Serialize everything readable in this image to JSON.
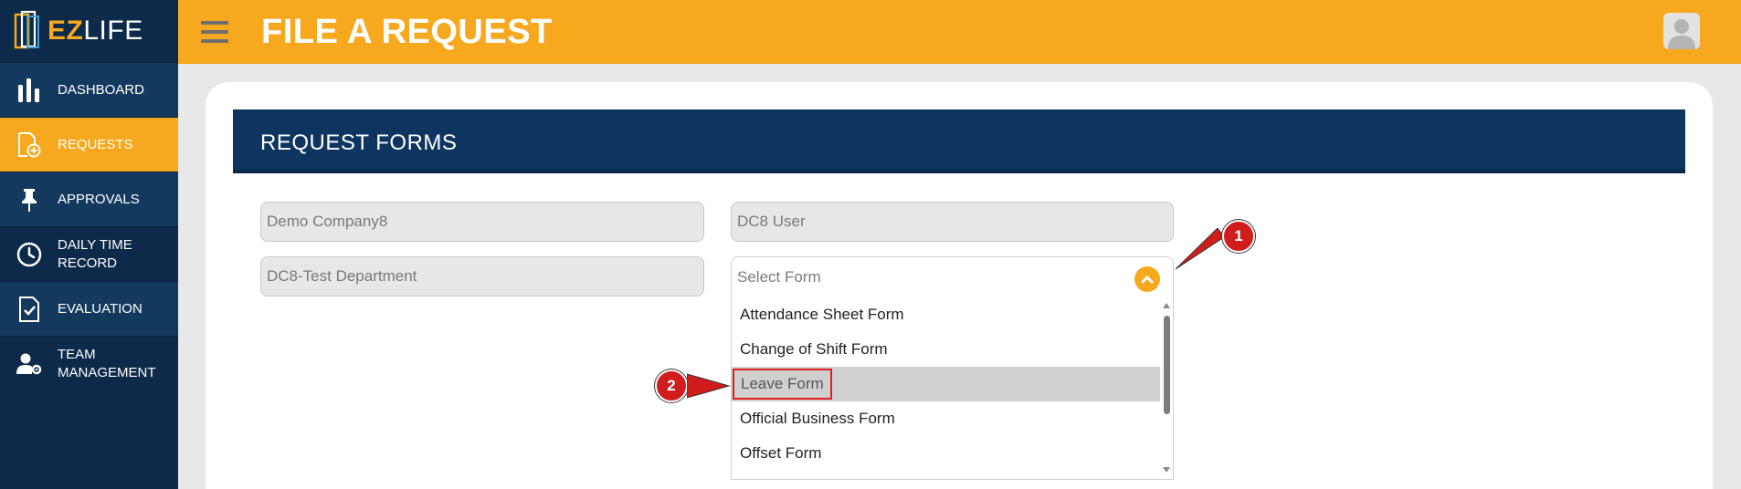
{
  "brand": {
    "logo_e": "E",
    "logo_z": "Z",
    "logo_rest": "LIFE"
  },
  "sidebar": {
    "items": [
      {
        "label": "DASHBOARD",
        "icon": "bar-chart-icon"
      },
      {
        "label": "REQUESTS",
        "icon": "document-add-icon"
      },
      {
        "label": "APPROVALS",
        "icon": "pin-icon"
      },
      {
        "label": "DAILY TIME",
        "label2": "RECORD",
        "icon": "clock-icon"
      },
      {
        "label": "EVALUATION",
        "icon": "checklist-icon"
      },
      {
        "label": "TEAM",
        "label2": "MANAGEMENT",
        "icon": "user-gear-icon"
      }
    ]
  },
  "header": {
    "title": "FILE A REQUEST"
  },
  "section": {
    "title": "REQUEST FORMS"
  },
  "form": {
    "company": "Demo Company8",
    "user": "DC8 User",
    "department": "DC8-Test Department",
    "select_placeholder": "Select Form",
    "options": [
      "Attendance Sheet Form",
      "Change of Shift Form",
      "Leave Form",
      "Official Business Form",
      "Offset Form"
    ],
    "highlighted_option": "Leave Form"
  },
  "callouts": {
    "one": "1",
    "two": "2"
  },
  "colors": {
    "accent": "#f6a91f",
    "sidebar": "#0d2a4a",
    "section_bar": "#0d3560",
    "callout": "#d11c1c"
  }
}
